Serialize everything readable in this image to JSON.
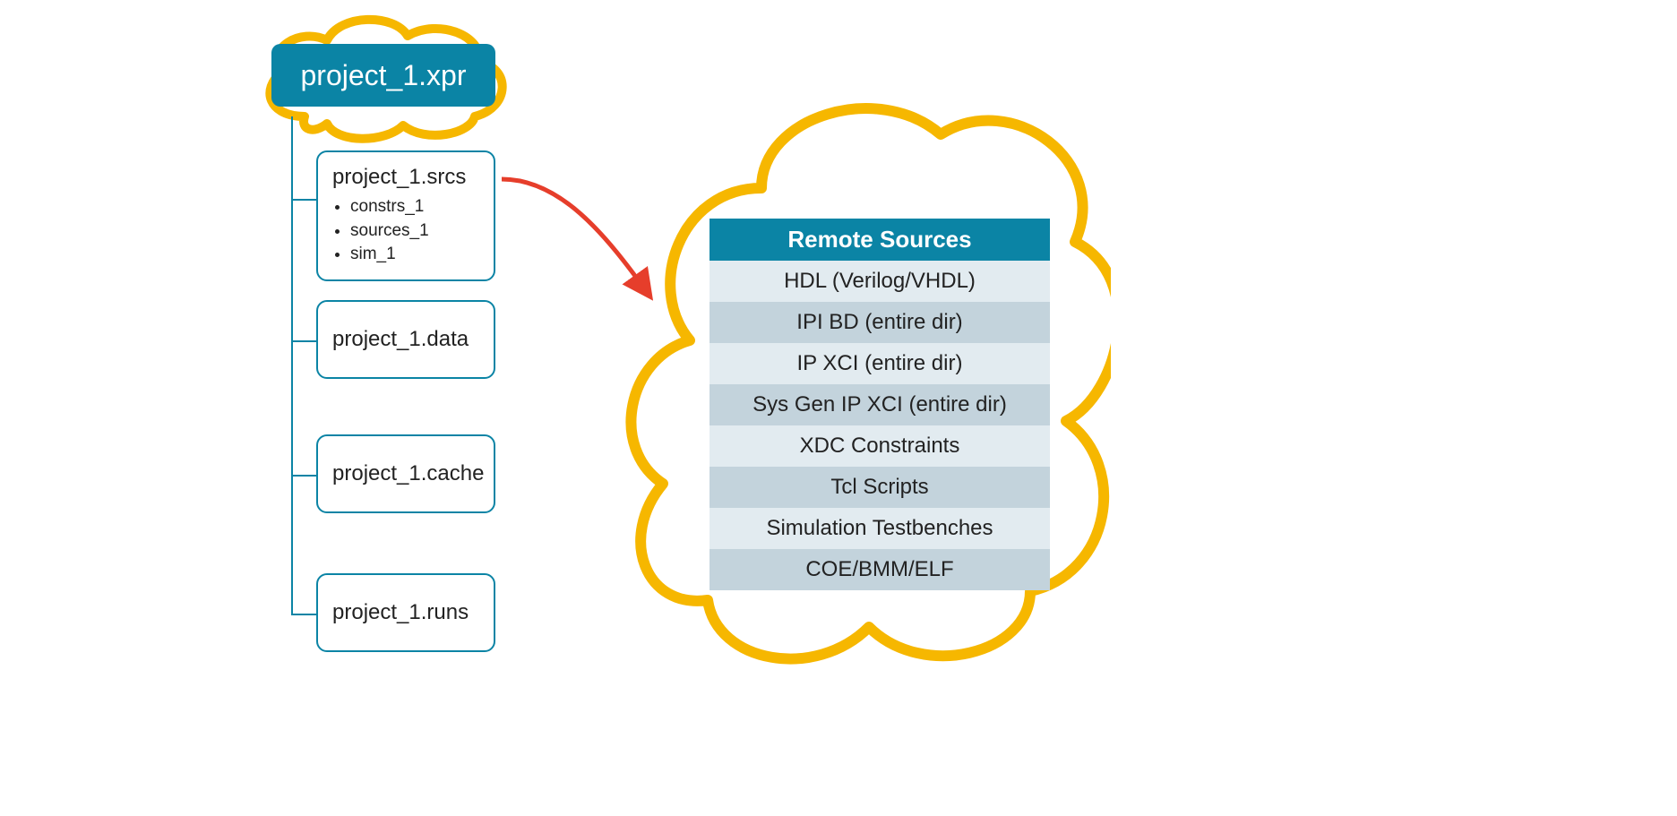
{
  "root": {
    "label": "project_1.xpr"
  },
  "tree": {
    "srcs": {
      "title": "project_1.srcs",
      "items": [
        "constrs_1",
        "sources_1",
        "sim_1"
      ]
    },
    "data_node": {
      "title": "project_1.data"
    },
    "cache_node": {
      "title": "project_1.cache"
    },
    "runs_node": {
      "title": "project_1.runs"
    }
  },
  "remote": {
    "title": "Remote Sources",
    "rows": [
      "HDL (Verilog/VHDL)",
      "IPI BD (entire dir)",
      "IP XCI (entire dir)",
      "Sys Gen IP XCI (entire dir)",
      "XDC Constraints",
      "Tcl Scripts",
      "Simulation Testbenches",
      "COE/BMM/ELF"
    ]
  },
  "colors": {
    "accent": "#0b84a5",
    "cloud": "#f6b700",
    "arrow": "#e63e2b"
  }
}
